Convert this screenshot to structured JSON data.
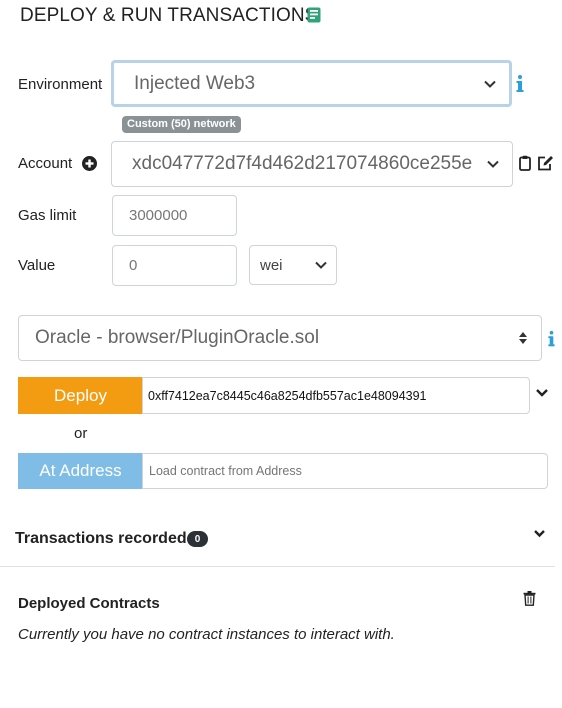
{
  "header": {
    "title": "DEPLOY & RUN TRANSACTIONS",
    "icon": "book-icon",
    "icon_color": "#2fa37a"
  },
  "environment": {
    "label": "Environment",
    "value": "Injected Web3",
    "network_badge": "Custom (50) network"
  },
  "account": {
    "label": "Account",
    "value": "xdc047772d7f4d462d217074860ce255e"
  },
  "gas_limit": {
    "label": "Gas limit",
    "value": "3000000"
  },
  "value": {
    "label": "Value",
    "amount": "0",
    "unit": "wei"
  },
  "contract": {
    "selected": "Oracle - browser/PluginOracle.sol"
  },
  "deploy": {
    "button_label": "Deploy",
    "args_value": "0xff7412ea7c8445c46a8254dfb557ac1e48094391",
    "button_color": "#f39c12"
  },
  "separator": {
    "or_text": "or"
  },
  "at_address": {
    "button_label": "At Address",
    "placeholder": "Load contract from Address",
    "button_color": "#7fbde6"
  },
  "transactions": {
    "label": "Transactions recorded:",
    "count": "0"
  },
  "deployed": {
    "title": "Deployed Contracts",
    "empty_message": "Currently you have no contract instances to interact with."
  },
  "colors": {
    "info": "#2a9fd8"
  }
}
